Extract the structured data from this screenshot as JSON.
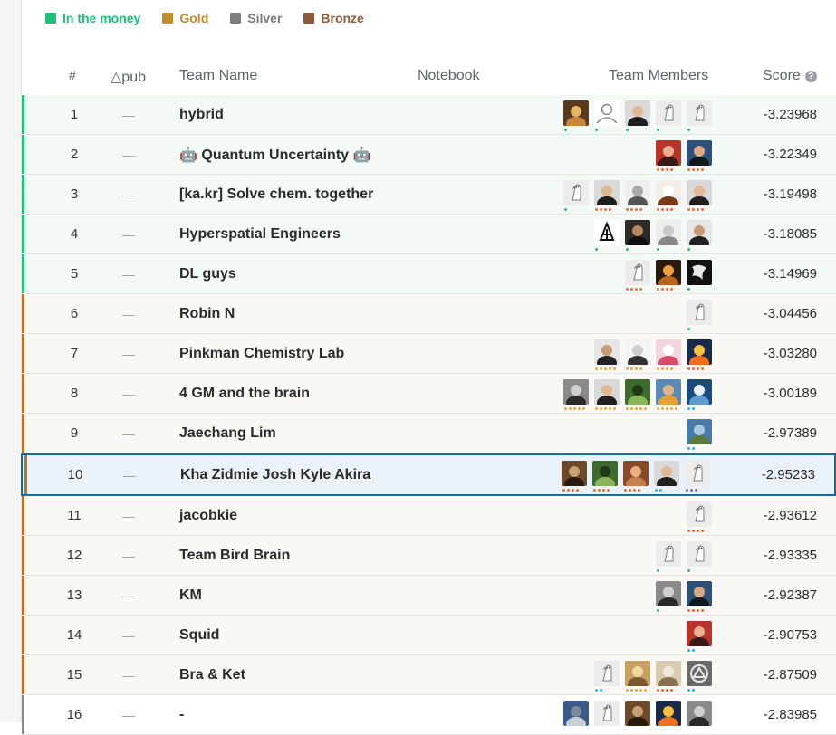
{
  "legend": [
    {
      "label": "In the money",
      "color": "#20be79"
    },
    {
      "label": "Gold",
      "color": "#c18c2b"
    },
    {
      "label": "Silver",
      "color": "#7d7d7d"
    },
    {
      "label": "Bronze",
      "color": "#8b5a3a"
    }
  ],
  "header": {
    "rank": "#",
    "delta": "△pub",
    "team": "Team Name",
    "notebook": "Notebook",
    "members": "Team Members",
    "score": "Score"
  },
  "tier_colors": {
    "money": "#20be79",
    "bronze": "#b6732b",
    "silver": "#8a8a8a",
    "selected": "#1a6d96"
  },
  "dot_colors": {
    "green": "#20be79",
    "orange": "#f06c3c",
    "gold": "#e5a93b",
    "blue": "#2ab6e8",
    "purple": "#8e68b7"
  },
  "rows": [
    {
      "rank": "1",
      "delta": "—",
      "team": "hybrid",
      "score": "-3.23968",
      "tier": "money",
      "members": [
        {
          "avatar": "photo-food",
          "dots": [
            "green"
          ]
        },
        {
          "avatar": "default-person",
          "dots": [
            "green"
          ]
        },
        {
          "avatar": "photo-person",
          "dots": [
            "green"
          ]
        },
        {
          "avatar": "goose",
          "dots": [
            "green"
          ]
        },
        {
          "avatar": "goose",
          "dots": [
            "green"
          ]
        }
      ]
    },
    {
      "rank": "2",
      "delta": "—",
      "team": "🤖 Quantum Uncertainty 🤖",
      "score": "-3.22349",
      "tier": "money",
      "members": [
        {
          "avatar": "photo-person-red",
          "dots": [
            "orange",
            "orange",
            "orange",
            "orange"
          ]
        },
        {
          "avatar": "photo-person-blue",
          "dots": [
            "orange",
            "orange",
            "orange",
            "orange"
          ]
        }
      ]
    },
    {
      "rank": "3",
      "delta": "—",
      "team": "[ka.kr] Solve chem. together",
      "score": "-3.19498",
      "tier": "money",
      "members": [
        {
          "avatar": "goose",
          "dots": [
            "green"
          ]
        },
        {
          "avatar": "photo-person",
          "dots": [
            "orange",
            "orange",
            "orange",
            "orange"
          ]
        },
        {
          "avatar": "photo-grid",
          "dots": [
            "orange",
            "orange",
            "orange",
            "orange"
          ]
        },
        {
          "avatar": "photo-dog",
          "dots": [
            "orange",
            "orange",
            "orange",
            "orange"
          ]
        },
        {
          "avatar": "photo-person",
          "dots": [
            "orange",
            "orange",
            "orange",
            "orange"
          ]
        }
      ]
    },
    {
      "rank": "4",
      "delta": "—",
      "team": "Hyperspatial Engineers",
      "score": "-3.18085",
      "tier": "money",
      "members": [
        {
          "avatar": "logo-black",
          "dots": [
            "green"
          ]
        },
        {
          "avatar": "photo-person-dark",
          "dots": [
            "green"
          ]
        },
        {
          "avatar": "photo-sphere",
          "dots": [
            "green"
          ]
        },
        {
          "avatar": "photo-bearded",
          "dots": [
            "green"
          ]
        }
      ]
    },
    {
      "rank": "5",
      "delta": "—",
      "team": "DL guys",
      "score": "-3.14969",
      "tier": "money",
      "members": [
        {
          "avatar": "goose",
          "dots": [
            "orange",
            "orange",
            "orange",
            "orange"
          ]
        },
        {
          "avatar": "photo-food-dark",
          "dots": [
            "orange",
            "orange",
            "orange",
            "orange"
          ]
        },
        {
          "avatar": "logo-dark",
          "dots": [
            "green"
          ]
        }
      ]
    },
    {
      "rank": "6",
      "delta": "—",
      "team": "Robin N",
      "score": "-3.04456",
      "tier": "bronze",
      "members": [
        {
          "avatar": "goose",
          "dots": [
            "green"
          ]
        }
      ]
    },
    {
      "rank": "7",
      "delta": "—",
      "team": "Pinkman Chemistry Lab",
      "score": "-3.03280",
      "tier": "bronze",
      "members": [
        {
          "avatar": "photo-bearded",
          "dots": [
            "gold",
            "gold",
            "gold",
            "gold",
            "gold"
          ]
        },
        {
          "avatar": "photo-white",
          "dots": [
            "gold",
            "gold",
            "gold",
            "gold"
          ]
        },
        {
          "avatar": "photo-pink",
          "dots": [
            "gold",
            "gold",
            "gold",
            "gold"
          ]
        },
        {
          "avatar": "photo-sunset",
          "dots": [
            "orange",
            "orange",
            "orange",
            "orange"
          ]
        }
      ]
    },
    {
      "rank": "8",
      "delta": "—",
      "team": "4 GM and the brain",
      "score": "-3.00189",
      "tier": "bronze",
      "members": [
        {
          "avatar": "photo-person-bw",
          "dots": [
            "gold",
            "gold",
            "gold",
            "gold",
            "gold"
          ]
        },
        {
          "avatar": "photo-person",
          "dots": [
            "gold",
            "gold",
            "gold",
            "gold",
            "gold"
          ]
        },
        {
          "avatar": "photo-green",
          "dots": [
            "gold",
            "gold",
            "gold",
            "gold",
            "gold"
          ]
        },
        {
          "avatar": "photo-cap",
          "dots": [
            "gold",
            "gold",
            "gold",
            "gold",
            "gold"
          ]
        },
        {
          "avatar": "photo-mountain",
          "dots": [
            "blue",
            "blue"
          ]
        }
      ]
    },
    {
      "rank": "9",
      "delta": "—",
      "team": "Jaechang Lim",
      "score": "-2.97389",
      "tier": "bronze",
      "members": [
        {
          "avatar": "photo-landscape",
          "dots": [
            "blue",
            "blue"
          ]
        }
      ]
    },
    {
      "rank": "10",
      "delta": "—",
      "team": "Kha Zidmie Josh Kyle Akira",
      "score": "-2.95233",
      "tier": "bronze",
      "selected": true,
      "members": [
        {
          "avatar": "photo-dog-brown",
          "dots": [
            "orange",
            "orange",
            "orange",
            "orange"
          ]
        },
        {
          "avatar": "photo-green",
          "dots": [
            "orange",
            "orange",
            "orange",
            "orange"
          ]
        },
        {
          "avatar": "photo-brown",
          "dots": [
            "orange",
            "orange",
            "orange",
            "orange"
          ]
        },
        {
          "avatar": "photo-person",
          "dots": [
            "blue",
            "blue"
          ]
        },
        {
          "avatar": "goose",
          "dots": [
            "purple",
            "purple",
            "purple"
          ]
        }
      ]
    },
    {
      "rank": "11",
      "delta": "—",
      "team": "jacobkie",
      "score": "-2.93612",
      "tier": "bronze",
      "members": [
        {
          "avatar": "goose",
          "dots": [
            "orange",
            "orange",
            "orange",
            "orange"
          ]
        }
      ]
    },
    {
      "rank": "12",
      "delta": "—",
      "team": "Team Bird Brain",
      "score": "-2.93335",
      "tier": "bronze",
      "members": [
        {
          "avatar": "goose",
          "dots": [
            "green"
          ]
        },
        {
          "avatar": "goose",
          "dots": [
            "green"
          ]
        }
      ]
    },
    {
      "rank": "13",
      "delta": "—",
      "team": "KM",
      "score": "-2.92387",
      "tier": "bronze",
      "members": [
        {
          "avatar": "photo-person-bw",
          "dots": [
            "green"
          ]
        },
        {
          "avatar": "photo-person-blue",
          "dots": [
            "orange",
            "orange",
            "orange",
            "orange"
          ]
        }
      ]
    },
    {
      "rank": "14",
      "delta": "—",
      "team": "Squid",
      "score": "-2.90753",
      "tier": "bronze",
      "members": [
        {
          "avatar": "photo-person-red",
          "dots": [
            "blue",
            "blue"
          ]
        }
      ]
    },
    {
      "rank": "15",
      "delta": "—",
      "team": "Bra & Ket",
      "score": "-2.87509",
      "tier": "bronze",
      "members": [
        {
          "avatar": "goose",
          "dots": [
            "blue",
            "blue"
          ]
        },
        {
          "avatar": "photo-landscape-warm",
          "dots": [
            "gold",
            "gold",
            "gold",
            "gold",
            "gold"
          ]
        },
        {
          "avatar": "photo-cat",
          "dots": [
            "orange",
            "orange",
            "orange",
            "orange"
          ]
        },
        {
          "avatar": "logo-gray",
          "dots": [
            "blue",
            "blue"
          ]
        }
      ]
    },
    {
      "rank": "16",
      "delta": "—",
      "team": "-",
      "score": "-2.83985",
      "tier": "silver",
      "members": [
        {
          "avatar": "photo-building",
          "dots": []
        },
        {
          "avatar": "goose",
          "dots": []
        },
        {
          "avatar": "photo-dog-brown",
          "dots": []
        },
        {
          "avatar": "photo-sunset",
          "dots": []
        },
        {
          "avatar": "photo-person-bw",
          "dots": []
        }
      ]
    }
  ]
}
